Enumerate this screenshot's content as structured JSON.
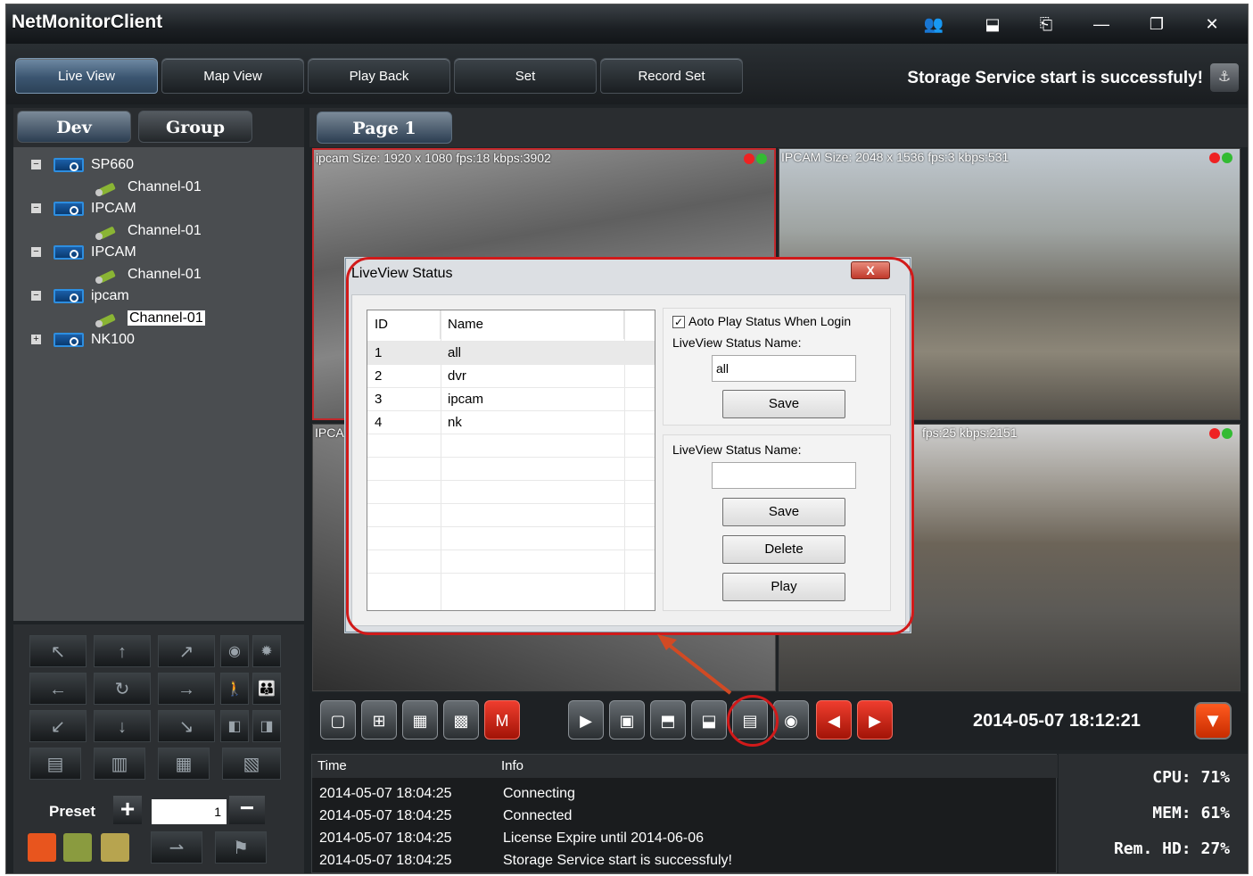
{
  "app": {
    "title": "NetMonitorClient"
  },
  "titlebar_buttons": [
    "users-icon",
    "layout-icon",
    "dock-icon",
    "minimize-icon",
    "restore-icon",
    "close-icon"
  ],
  "nav": {
    "tabs": [
      {
        "label": "Live View",
        "active": true
      },
      {
        "label": "Map View",
        "active": false
      },
      {
        "label": "Play Back",
        "active": false
      },
      {
        "label": "Set",
        "active": false
      },
      {
        "label": "Record Set",
        "active": false
      }
    ],
    "storage_message": "Storage Service start is successfuly!"
  },
  "left": {
    "tabs": [
      {
        "label": "Dev",
        "active": true
      },
      {
        "label": "Group",
        "active": false
      }
    ],
    "tree": [
      {
        "name": "SP660",
        "expanded": true,
        "channel": "Channel-01"
      },
      {
        "name": "IPCAM",
        "expanded": true,
        "channel": "Channel-01"
      },
      {
        "name": "IPCAM",
        "expanded": true,
        "channel": "Channel-01"
      },
      {
        "name": "ipcam",
        "expanded": true,
        "channel": "Channel-01",
        "selected": true
      },
      {
        "name": "NK100",
        "expanded": false,
        "channel": null
      }
    ]
  },
  "ptz": {
    "preset_label": "Preset",
    "preset_value": "1",
    "buttons": [
      "up-left-arrow",
      "up-arrow",
      "up-right-arrow",
      "down-left-arrow",
      "down-arrow",
      "down-right-arrow",
      "left-arrow",
      "rotate-icon",
      "right-arrow"
    ]
  },
  "video": {
    "page_tab": "Page 1",
    "panes": [
      {
        "label": "ipcam Size: 1920 x 1080 fps:18 kbps:3902",
        "selected": true
      },
      {
        "label": "IPCAM Size: 2048 x 1536 fps:3 kbps:531",
        "selected": false
      },
      {
        "label": "IPCA",
        "selected": false
      },
      {
        "label": "fps:25 kbps:2151",
        "selected": false
      }
    ]
  },
  "toolbar": {
    "clock": "2014-05-07 18:12:21"
  },
  "log": {
    "headers": {
      "time": "Time",
      "info": "Info"
    },
    "rows": [
      {
        "time": "2014-05-07 18:04:25",
        "info": "Connecting"
      },
      {
        "time": "2014-05-07 18:04:25",
        "info": "Connected"
      },
      {
        "time": "2014-05-07 18:04:25",
        "info": "License Expire until 2014-06-06"
      },
      {
        "time": "2014-05-07 18:04:25",
        "info": "Storage Service start is successfuly!"
      }
    ]
  },
  "sysinfo": {
    "cpu": "CPU:  71%",
    "mem": "MEM:  61%",
    "hd": "Rem. HD:  27%"
  },
  "dialog": {
    "title": "LiveView Status",
    "close": "X",
    "table": {
      "headers": {
        "id": "ID",
        "name": "Name"
      },
      "rows": [
        {
          "id": "1",
          "name": "all",
          "selected": true
        },
        {
          "id": "2",
          "name": "dvr"
        },
        {
          "id": "3",
          "name": "ipcam"
        },
        {
          "id": "4",
          "name": "nk"
        }
      ]
    },
    "auto_play_label": "Aoto Play Status When Login",
    "auto_play_checked": true,
    "status_name_label": "LiveView Status Name:",
    "status_name_value": "all",
    "save_label": "Save",
    "status_name_label2": "LiveView Status Name:",
    "status_name_value2": "",
    "save_label2": "Save",
    "delete_label": "Delete",
    "play_label": "Play"
  },
  "colors": {
    "accent_red": "#d11a1a",
    "active_tab": "#3b5570"
  }
}
